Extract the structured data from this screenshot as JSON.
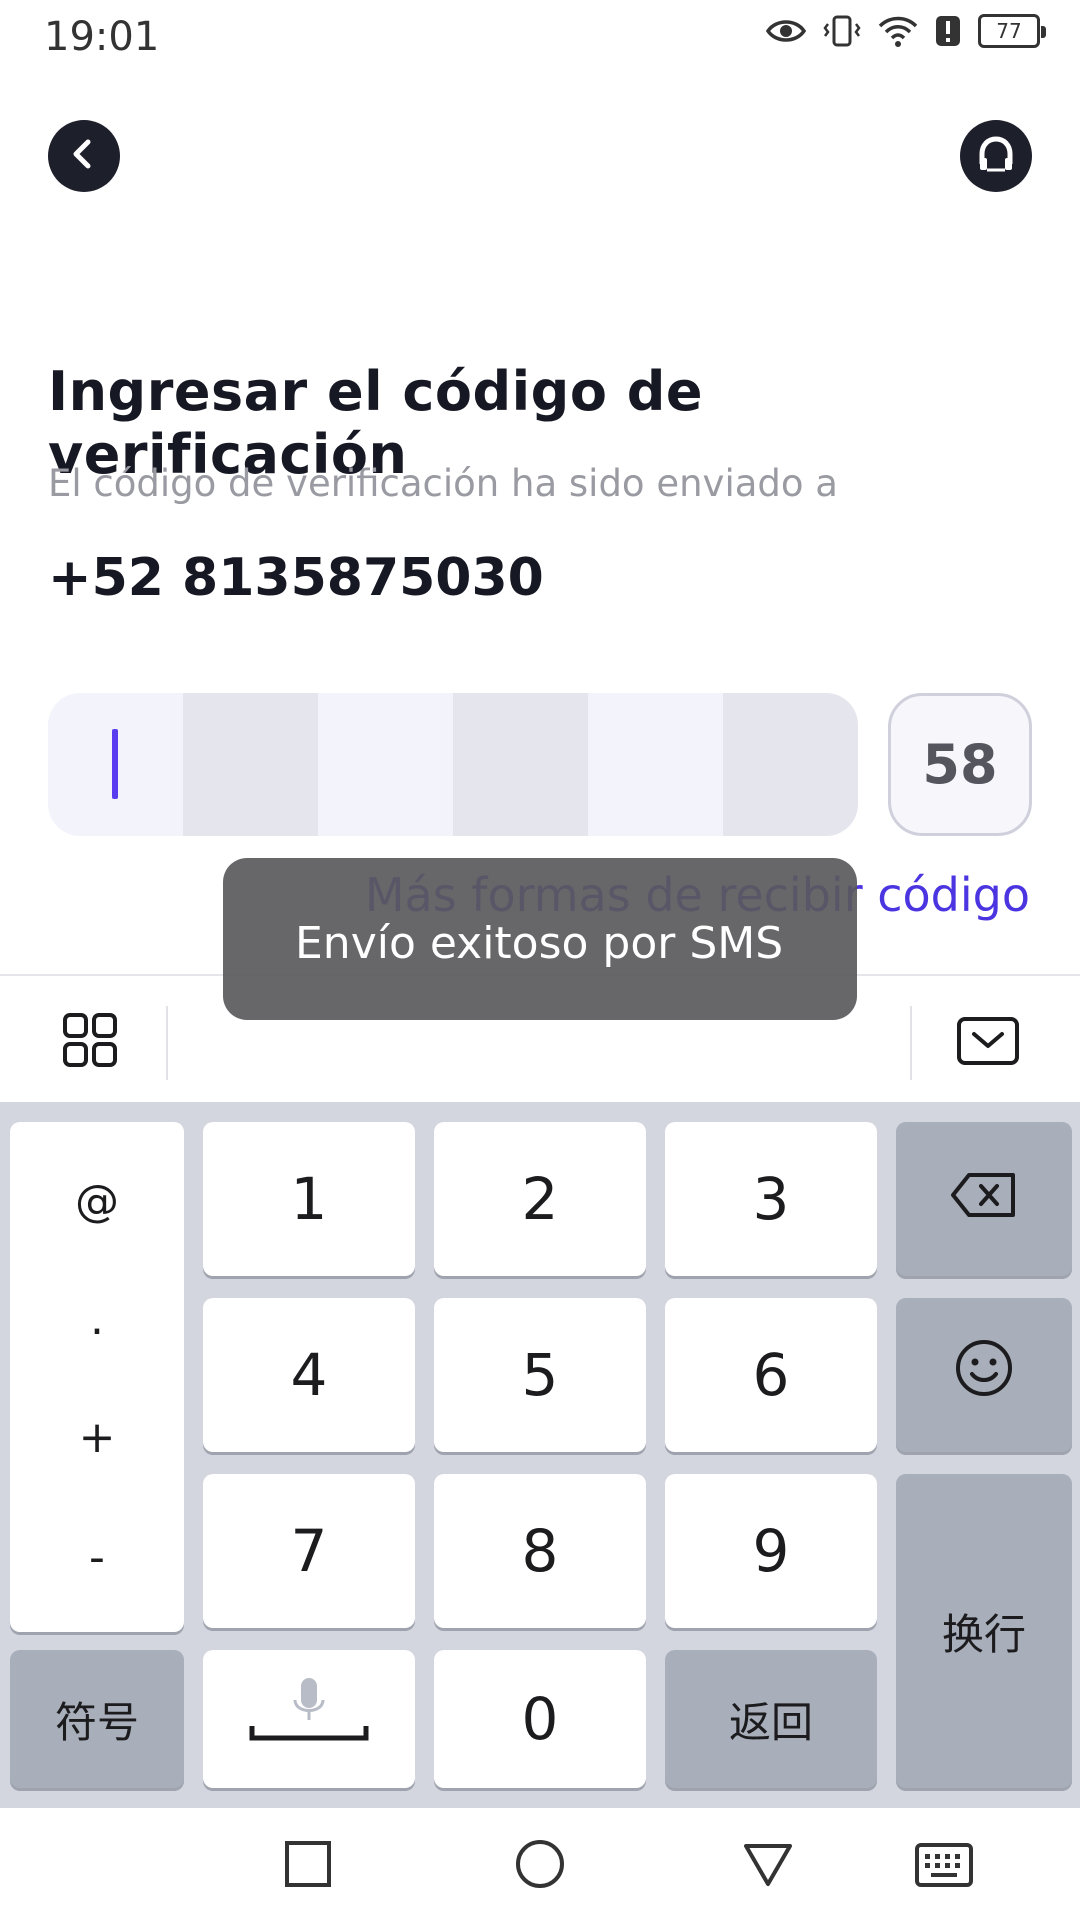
{
  "status_bar": {
    "time": "19:01",
    "battery": "77",
    "icons": [
      "eye-icon",
      "vibrate-icon",
      "wifi-icon",
      "alert-icon",
      "battery-icon"
    ]
  },
  "header": {
    "back_icon": "chevron-left-icon",
    "support_icon": "headset-icon"
  },
  "main": {
    "title": "Ingresar el código de verificación",
    "subtitle": "El código de verificación ha sido enviado a",
    "phone": "+52 8135875030",
    "code_cells": [
      "",
      "",
      "",
      "",
      "",
      ""
    ],
    "timer": "58",
    "more_ways_link": "Más formas de recibir código"
  },
  "toast": {
    "text": "Envío exitoso por SMS"
  },
  "keyboard": {
    "toolbar_icons": [
      "apps-grid-icon",
      "hide-keyboard-icon"
    ],
    "symbols": [
      "@",
      ".",
      "+",
      "-"
    ],
    "digits": [
      "1",
      "2",
      "3",
      "4",
      "5",
      "6",
      "7",
      "8",
      "9",
      "0"
    ],
    "backspace_icon": "backspace-icon",
    "emoji_icon": "emoji-icon",
    "enter_label": "换行",
    "symbols_label": "符号",
    "voice_icon": "microphone-icon",
    "return_label": "返回"
  },
  "navbar": {
    "icons": [
      "recent-apps-icon",
      "home-icon",
      "back-icon",
      "keyboard-icon"
    ]
  },
  "colors": {
    "accent": "#4b35e0",
    "dark_button": "#1d1f2b",
    "toast_bg": "#5a5a5c",
    "keyboard_bg": "#d3d6de",
    "fn_key": "#a8aeba"
  }
}
